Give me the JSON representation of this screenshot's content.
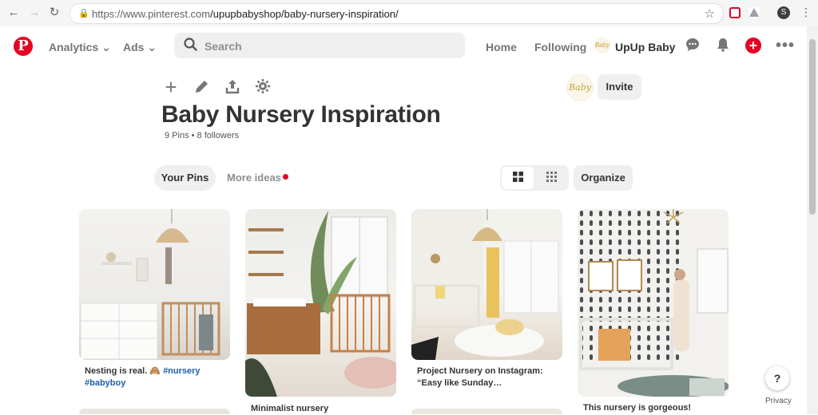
{
  "browser": {
    "url_host": "https://www.pinterest.com",
    "url_path": "/upupbabyshop/baby-nursery-inspiration/",
    "profile_initial": "S"
  },
  "topnav": {
    "analytics": "Analytics",
    "ads": "Ads",
    "search_placeholder": "Search",
    "home": "Home",
    "following": "Following",
    "user_name": "UpUp Baby",
    "user_avatar_text": "Baby"
  },
  "board": {
    "title": "Baby Nursery Inspiration",
    "meta": "9 Pins • 8 followers",
    "owner_avatar_text": "Baby",
    "invite": "Invite",
    "organize": "Organize",
    "tabs": {
      "your_pins": "Your Pins",
      "more_ideas": "More ideas"
    }
  },
  "pins": [
    {
      "title_text": "Nesting is real. 🙈 ",
      "tag1": "#nursery",
      "tag2": "#babyboy"
    },
    {
      "title_text": "Minimalist nursery"
    },
    {
      "title_text": "Project Nursery on Instagram: “Easy like Sunday…"
    },
    {
      "title_text": "This nursery is gorgeous!"
    }
  ],
  "help": {
    "label": "?",
    "privacy": "Privacy"
  },
  "colors": {
    "brand_red": "#e60023",
    "tag_blue": "#1d5fa8"
  }
}
